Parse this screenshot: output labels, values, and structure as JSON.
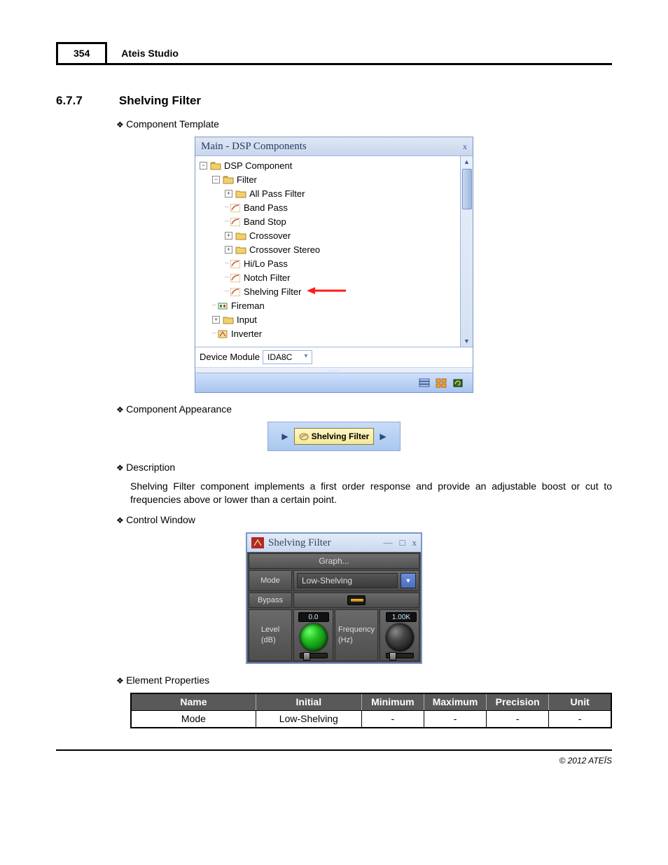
{
  "header": {
    "page_number": "354",
    "app_name": "Ateis Studio"
  },
  "section": {
    "number": "6.7.7",
    "title": "Shelving Filter"
  },
  "bullets": {
    "template": "Component Template",
    "appearance": "Component Appearance",
    "description": "Description",
    "control": "Control Window",
    "element_props": "Element Properties"
  },
  "description_text": "Shelving Filter component implements a first order response and provide an adjustable boost or cut to frequencies above or lower than a certain point.",
  "dsp_window": {
    "title": "Main - DSP Components",
    "close": "x",
    "tree": {
      "root": "DSP Component",
      "filter": "Filter",
      "items": [
        "All Pass Filter",
        "Band Pass",
        "Band Stop",
        "Crossover",
        "Crossover Stereo",
        "Hi/Lo Pass",
        "Notch Filter",
        "Shelving Filter"
      ],
      "fireman": "Fireman",
      "input": "Input",
      "inverter": "Inverter"
    },
    "device_label": "Device Module",
    "device_value": "IDA8C"
  },
  "comp_appearance": {
    "label": "Shelving Filter"
  },
  "control_window": {
    "title": "Shelving Filter",
    "graph": "Graph...",
    "mode_label": "Mode",
    "mode_value": "Low-Shelving",
    "bypass_label": "Bypass",
    "level_label": "Level\n(dB)",
    "level_value": "0.0",
    "freq_label": "Frequency\n(Hz)",
    "freq_value": "1.00K"
  },
  "props_table": {
    "headers": [
      "Name",
      "Initial",
      "Minimum",
      "Maximum",
      "Precision",
      "Unit"
    ],
    "row": [
      "Mode",
      "Low-Shelving",
      "-",
      "-",
      "-",
      "-"
    ]
  },
  "footer": {
    "copyright": "© 2012 ATEÏS"
  }
}
